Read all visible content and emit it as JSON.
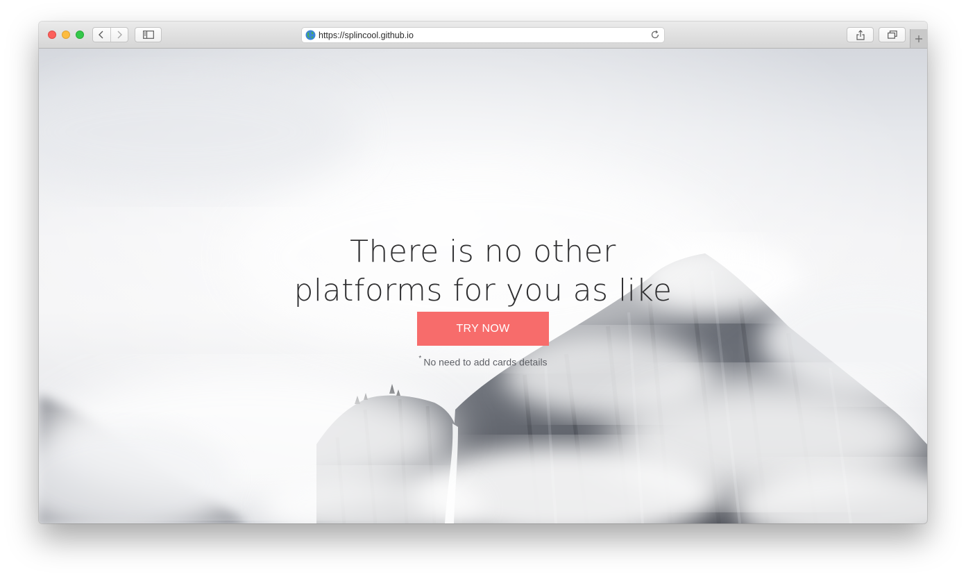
{
  "browser": {
    "url": "https://splincool.github.io",
    "icons": {
      "back": "chevron-left-icon",
      "forward": "chevron-right-icon",
      "sidebar": "sidebar-icon",
      "share": "share-icon",
      "tabs": "tabs-overview-icon",
      "new_tab": "plus-icon",
      "reload": "reload-icon",
      "site": "globe-icon"
    },
    "colors": {
      "close": "#fc605c",
      "minimize": "#fdbc40",
      "maximize": "#34c84a"
    }
  },
  "hero": {
    "headline_line1": "There is no other",
    "headline_line2": "platforms for you as like",
    "cta_label": "TRY NOW",
    "note_marker": "*",
    "note_text": "No need to add cards details",
    "cta_color": "#f76c6b"
  }
}
